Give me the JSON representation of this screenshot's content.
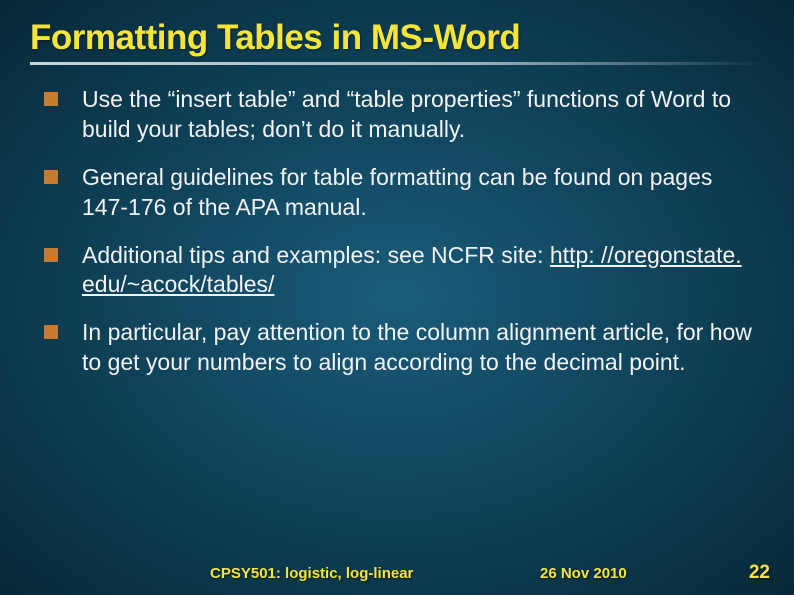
{
  "title": "Formatting Tables in MS-Word",
  "bullets": [
    {
      "text": "Use the “insert table” and “table properties” functions of Word to build your tables; don’t do it manually."
    },
    {
      "text": "General guidelines for table formatting can be found on pages 147-176 of the APA manual."
    },
    {
      "text_before": "Additional tips and examples: see NCFR site: ",
      "link": "http: //oregonstate. edu/~acock/tables/"
    },
    {
      "text": "In particular, pay attention to the column alignment article, for how to get your numbers to align according to the decimal point."
    }
  ],
  "footer": {
    "left": "CPSY501: logistic, log-linear",
    "center": "26 Nov 2010",
    "right": "22"
  }
}
